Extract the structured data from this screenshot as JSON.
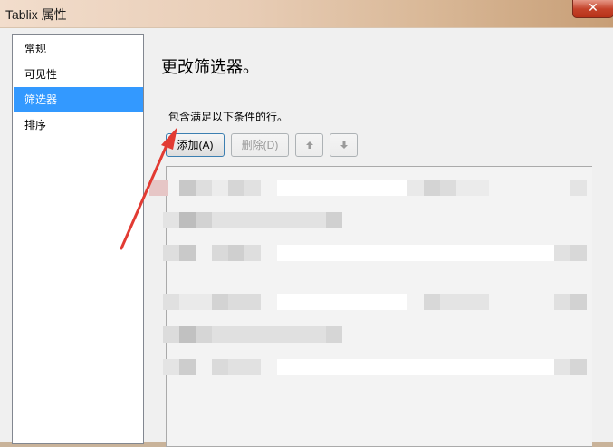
{
  "window": {
    "title": "Tablix 属性",
    "close_glyph": "✕"
  },
  "nav": {
    "items": [
      {
        "label": "常规",
        "selected": false
      },
      {
        "label": "可见性",
        "selected": false
      },
      {
        "label": "筛选器",
        "selected": true
      },
      {
        "label": "排序",
        "selected": false
      }
    ]
  },
  "main": {
    "heading": "更改筛选器。",
    "description": "包含满足以下条件的行。",
    "buttons": {
      "add": "添加(A)",
      "delete": "删除(D)",
      "move_up_icon": "arrow-up-icon",
      "move_down_icon": "arrow-down-icon"
    }
  },
  "colors": {
    "selection": "#3399ff",
    "annotation_arrow": "#e23b33",
    "close_button": "#c4422a"
  }
}
